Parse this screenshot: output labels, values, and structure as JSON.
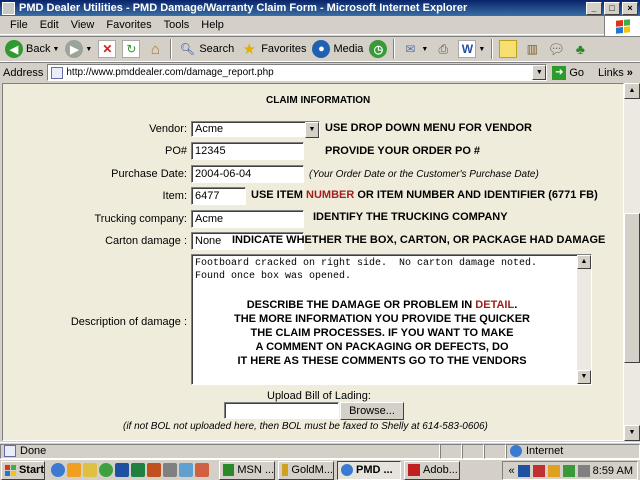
{
  "window": {
    "title": "PMD Dealer Utilities - PMD Damage/Warranty Claim Form - Microsoft Internet Explorer",
    "min": "_",
    "max": "□",
    "close": "×"
  },
  "menu": [
    "File",
    "Edit",
    "View",
    "Favorites",
    "Tools",
    "Help"
  ],
  "toolbar": {
    "back": "Back",
    "search": "Search",
    "favorites": "Favorites",
    "media": "Media"
  },
  "address": {
    "label": "Address",
    "url": "http://www.pmddealer.com/damage_report.php",
    "go": "Go",
    "links": "Links",
    "links_chevron": "»"
  },
  "form": {
    "heading": "CLAIM INFORMATION",
    "vendor": {
      "label": "Vendor:",
      "value": "Acme",
      "instruction": "USE DROP DOWN MENU FOR VENDOR"
    },
    "po": {
      "label": "PO#",
      "value": "12345",
      "instruction": "PROVIDE YOUR ORDER PO #"
    },
    "purchase_date": {
      "label": "Purchase Date:",
      "value": "2004-06-04",
      "note": "(Your Order Date or the Customer's Purchase Date)"
    },
    "item": {
      "label": "Item:",
      "value": "6477",
      "instruction_a": "USE ITEM ",
      "instruction_hl": "NUMBER",
      "instruction_b": " OR ITEM NUMBER AND IDENTIFIER (6771 FB)"
    },
    "trucking": {
      "label": "Trucking company:",
      "value": "Acme",
      "instruction": "IDENTIFY THE TRUCKING COMPANY"
    },
    "carton": {
      "label": "Carton damage :",
      "value": "None",
      "instruction": "INDICATE WHETHER THE BOX, CARTON, OR PACKAGE HAD DAMAGE"
    },
    "description": {
      "label": "Description of damage :",
      "text": "Footboard cracked on right side.  No carton damage noted.\nFound once box was opened.",
      "instr_line1_a": "DESCRIBE THE DAMAGE OR PROBLEM IN ",
      "instr_line1_hl": "DETAIL",
      "instr_line1_b": ".",
      "instr_line2": "THE MORE INFORMATION YOU PROVIDE THE QUICKER",
      "instr_line3": "THE CLAIM PROCESSES.  IF YOU WANT TO MAKE",
      "instr_line4": "A COMMENT ON PACKAGING OR DEFECTS, DO",
      "instr_line5": "IT HERE AS THESE COMMENTS GO TO THE VENDORS"
    },
    "upload": {
      "label": "Upload Bill of Lading:",
      "browse": "Browse...",
      "note": "(if not BOL not uploaded here, then BOL must be faxed to Shelly at 614-583-0606)"
    }
  },
  "status": {
    "text": "Done",
    "zone": "Internet"
  },
  "taskbar": {
    "start": "Start",
    "tasks": [
      "MSN ...",
      "GoldM...",
      "PMD ...",
      "Adob..."
    ],
    "expand": "«",
    "time": "8:59 AM"
  }
}
